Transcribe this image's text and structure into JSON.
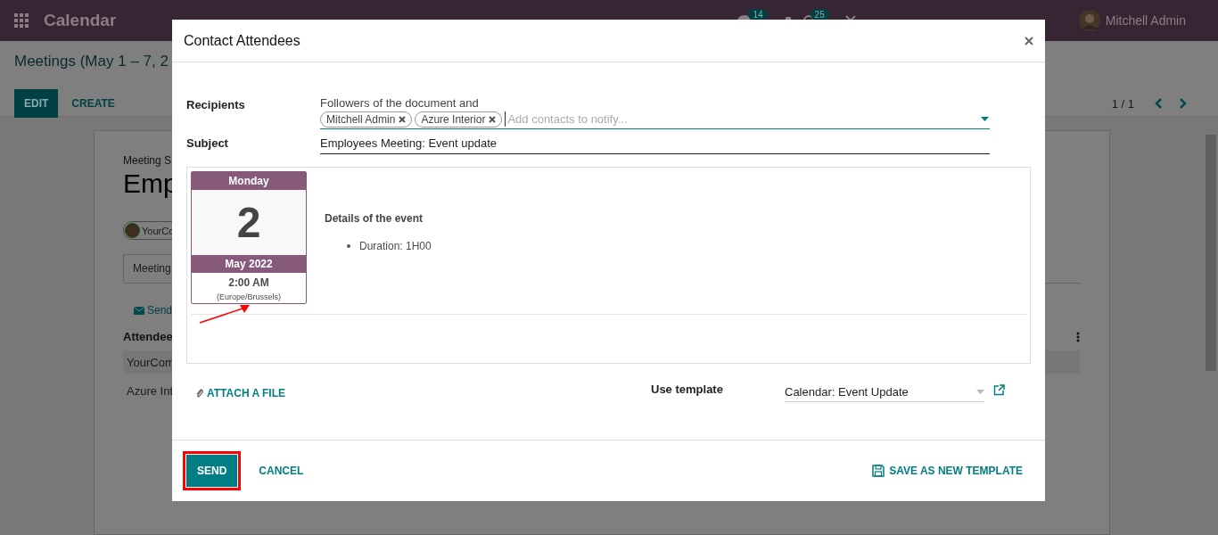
{
  "topbar": {
    "app_name": "Calendar",
    "chat_badge": "14",
    "activity_badge": "25",
    "user": "Mitchell Admin"
  },
  "control_panel": {
    "breadcrumb": "Meetings (May 1 – 7, 2",
    "buttons": [
      {
        "label": "EDIT",
        "kind": "primary"
      },
      {
        "label": "CREATE",
        "kind": "link"
      }
    ],
    "pager": "1 / 1"
  },
  "record": {
    "field_label": "Meeting S",
    "title": "Emp",
    "attendee_tag": "YourCo",
    "tab": "Meeting",
    "send_link": "Send",
    "column": "Attendee",
    "rows": [
      "YourCom",
      "Azure Int"
    ]
  },
  "dialog": {
    "title": "Contact Attendees",
    "recipients": {
      "label": "Recipients",
      "followers_text": "Followers of the document and",
      "tags": [
        "Mitchell Admin",
        "Azure Interior"
      ],
      "placeholder": "Add contacts to notify..."
    },
    "subject": {
      "label": "Subject",
      "value": "Employees Meeting: Event update"
    },
    "event_card": {
      "weekday": "Monday",
      "day": "2",
      "month": "May 2022",
      "time": "2:00 AM",
      "timezone": "(Europe/Brussels)"
    },
    "details_heading": "Details of the event",
    "details": [
      "Duration: 1H00"
    ],
    "attach": "ATTACH A FILE",
    "template": {
      "label": "Use template",
      "value": "Calendar: Event Update"
    },
    "buttons": [
      {
        "label": "SEND",
        "kind": "primary",
        "highlighted": true
      },
      {
        "label": "CANCEL",
        "kind": "link",
        "highlighted": false
      }
    ],
    "save_template": "SAVE AS NEW TEMPLATE",
    "annotations": [
      {
        "kind": "arrow"
      }
    ]
  }
}
